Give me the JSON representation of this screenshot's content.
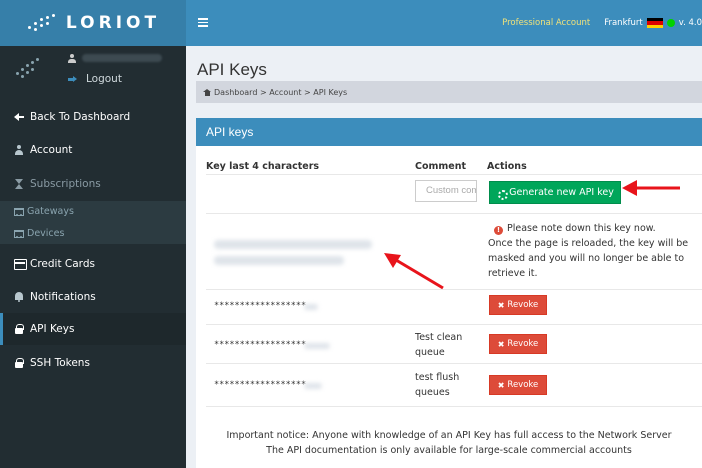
{
  "brand": {
    "name": "LORIOT"
  },
  "user": {
    "logout_label": "Logout"
  },
  "sidebar": {
    "items": [
      {
        "label": "Back To Dashboard",
        "icon": "arrow-left-icon"
      },
      {
        "label": "Account",
        "icon": "user-icon"
      },
      {
        "label": "Subscriptions",
        "icon": "hourglass-icon"
      },
      {
        "label": "Gateways",
        "icon": "cart-icon"
      },
      {
        "label": "Devices",
        "icon": "cart-icon"
      },
      {
        "label": "Credit Cards",
        "icon": "credit-card-icon"
      },
      {
        "label": "Notifications",
        "icon": "bell-icon"
      },
      {
        "label": "API Keys",
        "icon": "lock-icon"
      },
      {
        "label": "SSH Tokens",
        "icon": "lock-icon"
      }
    ]
  },
  "topbar": {
    "account_type": "Professional Account",
    "region": "Frankfurt",
    "version": "v. 4.0"
  },
  "page": {
    "title": "API Keys",
    "breadcrumb": "Dashboard > Account > API Keys"
  },
  "box": {
    "title": "API keys",
    "columns": {
      "key": "Key last 4 characters",
      "comment": "Comment",
      "actions": "Actions"
    },
    "comment_placeholder": "Custom comment",
    "generate_label": "Generate new API key",
    "notice": {
      "line1": "Please note down this key now.",
      "line2": "Once the page is reloaded, the key will be",
      "line3": "masked and you will no longer be able to",
      "line4": "retrieve it."
    },
    "rows": [
      {
        "key": "******************",
        "comment": "",
        "action": "Revoke"
      },
      {
        "key": "******************",
        "comment_line1": "Test clean",
        "comment_line2": "queue",
        "action": "Revoke"
      },
      {
        "key": "******************",
        "comment_line1": "test flush",
        "comment_line2": "queues",
        "action": "Revoke"
      }
    ],
    "footer_line1": "Important notice: Anyone with knowledge of an API Key has full access to the Network Server",
    "footer_line2": "The API documentation is only available for large-scale commercial accounts"
  },
  "colors": {
    "topbar": "#3c8dbc",
    "sidebar": "#222d32",
    "generate_button": "#00a65a",
    "revoke_button": "#dd4b39",
    "annotation_arrow": "#e8141b"
  }
}
